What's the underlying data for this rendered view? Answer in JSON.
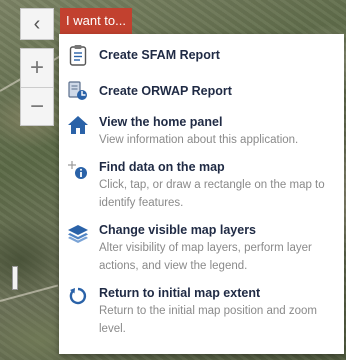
{
  "map": {
    "back_icon": "chevron-left-icon",
    "zoom_in_label": "+",
    "zoom_out_label": "−",
    "back_label": "‹"
  },
  "menu": {
    "button_label": "I want to...",
    "items": [
      {
        "title": "Create SFAM Report",
        "description": "",
        "icon": "clipboard-icon"
      },
      {
        "title": "Create ORWAP Report",
        "description": "",
        "icon": "report-tools-icon"
      },
      {
        "title": "View the home panel",
        "description": "View information about this application.",
        "icon": "home-icon"
      },
      {
        "title": "Find data on the map",
        "description": "Click, tap, or draw a rectangle on the map to identify features.",
        "icon": "identify-icon"
      },
      {
        "title": "Change visible map layers",
        "description": "Alter visibility of map layers, perform layer actions, and view the legend.",
        "icon": "layers-icon"
      },
      {
        "title": "Return to initial map extent",
        "description": "Return to the initial map position and zoom level.",
        "icon": "reset-extent-icon"
      }
    ]
  },
  "colors": {
    "menu_button": "#c2412f",
    "title_text": "#1f2a44",
    "desc_text": "#8a8a8a",
    "icon_blue": "#2a62a8"
  }
}
